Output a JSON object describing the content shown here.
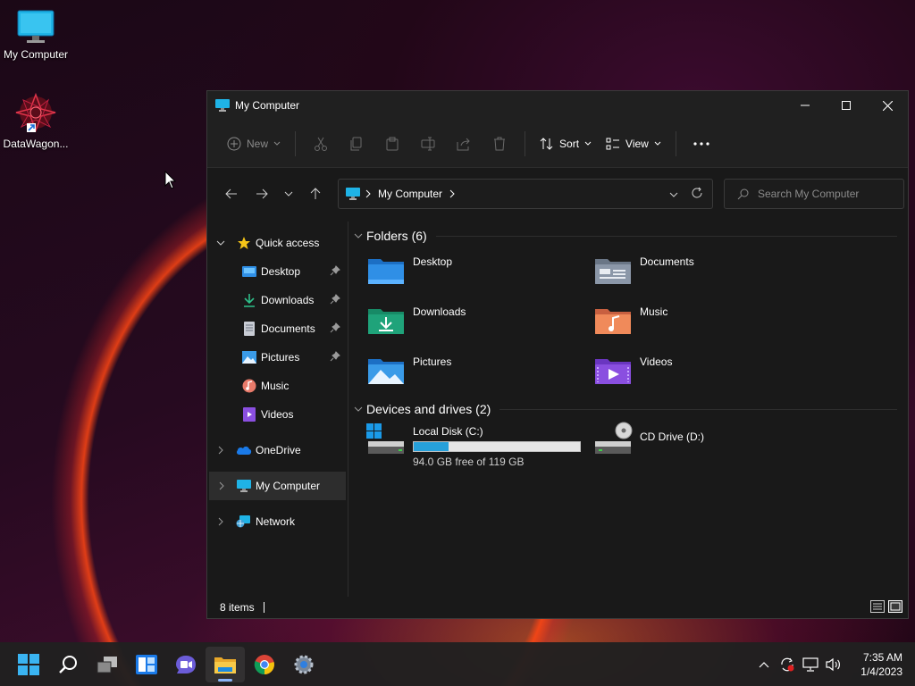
{
  "desktop": {
    "icons": [
      {
        "label": "My Computer",
        "icon": "monitor-icon"
      },
      {
        "label": "DataWagon...",
        "icon": "datawagon-logo-icon"
      }
    ]
  },
  "window": {
    "title": "My Computer",
    "toolbar": {
      "new_label": "New",
      "sort_label": "Sort",
      "view_label": "View"
    },
    "address": {
      "path": "My Computer"
    },
    "search": {
      "placeholder": "Search My Computer"
    },
    "sidebar": {
      "quick_access": "Quick access",
      "items": [
        {
          "label": "Desktop",
          "pinned": true
        },
        {
          "label": "Downloads",
          "pinned": true
        },
        {
          "label": "Documents",
          "pinned": true
        },
        {
          "label": "Pictures",
          "pinned": true
        },
        {
          "label": "Music",
          "pinned": false
        },
        {
          "label": "Videos",
          "pinned": false
        }
      ],
      "onedrive": "OneDrive",
      "my_computer": "My Computer",
      "network": "Network"
    },
    "content": {
      "folders_header": "Folders (6)",
      "folders": [
        {
          "name": "Desktop"
        },
        {
          "name": "Documents"
        },
        {
          "name": "Downloads"
        },
        {
          "name": "Music"
        },
        {
          "name": "Pictures"
        },
        {
          "name": "Videos"
        }
      ],
      "drives_header": "Devices and drives (2)",
      "drives": [
        {
          "name": "Local Disk (C:)",
          "free_text": "94.0 GB free of 119 GB",
          "used_fraction": 0.21
        },
        {
          "name": "CD Drive (D:)"
        }
      ]
    },
    "status": {
      "items": "8 items"
    }
  },
  "taskbar": {
    "time": "7:35 AM",
    "date": "1/4/2023"
  },
  "colors": {
    "accent": "#26a0da",
    "window_bg": "#191919",
    "folder_blue": "#2f8fe6",
    "folder_green": "#1fa37a"
  }
}
